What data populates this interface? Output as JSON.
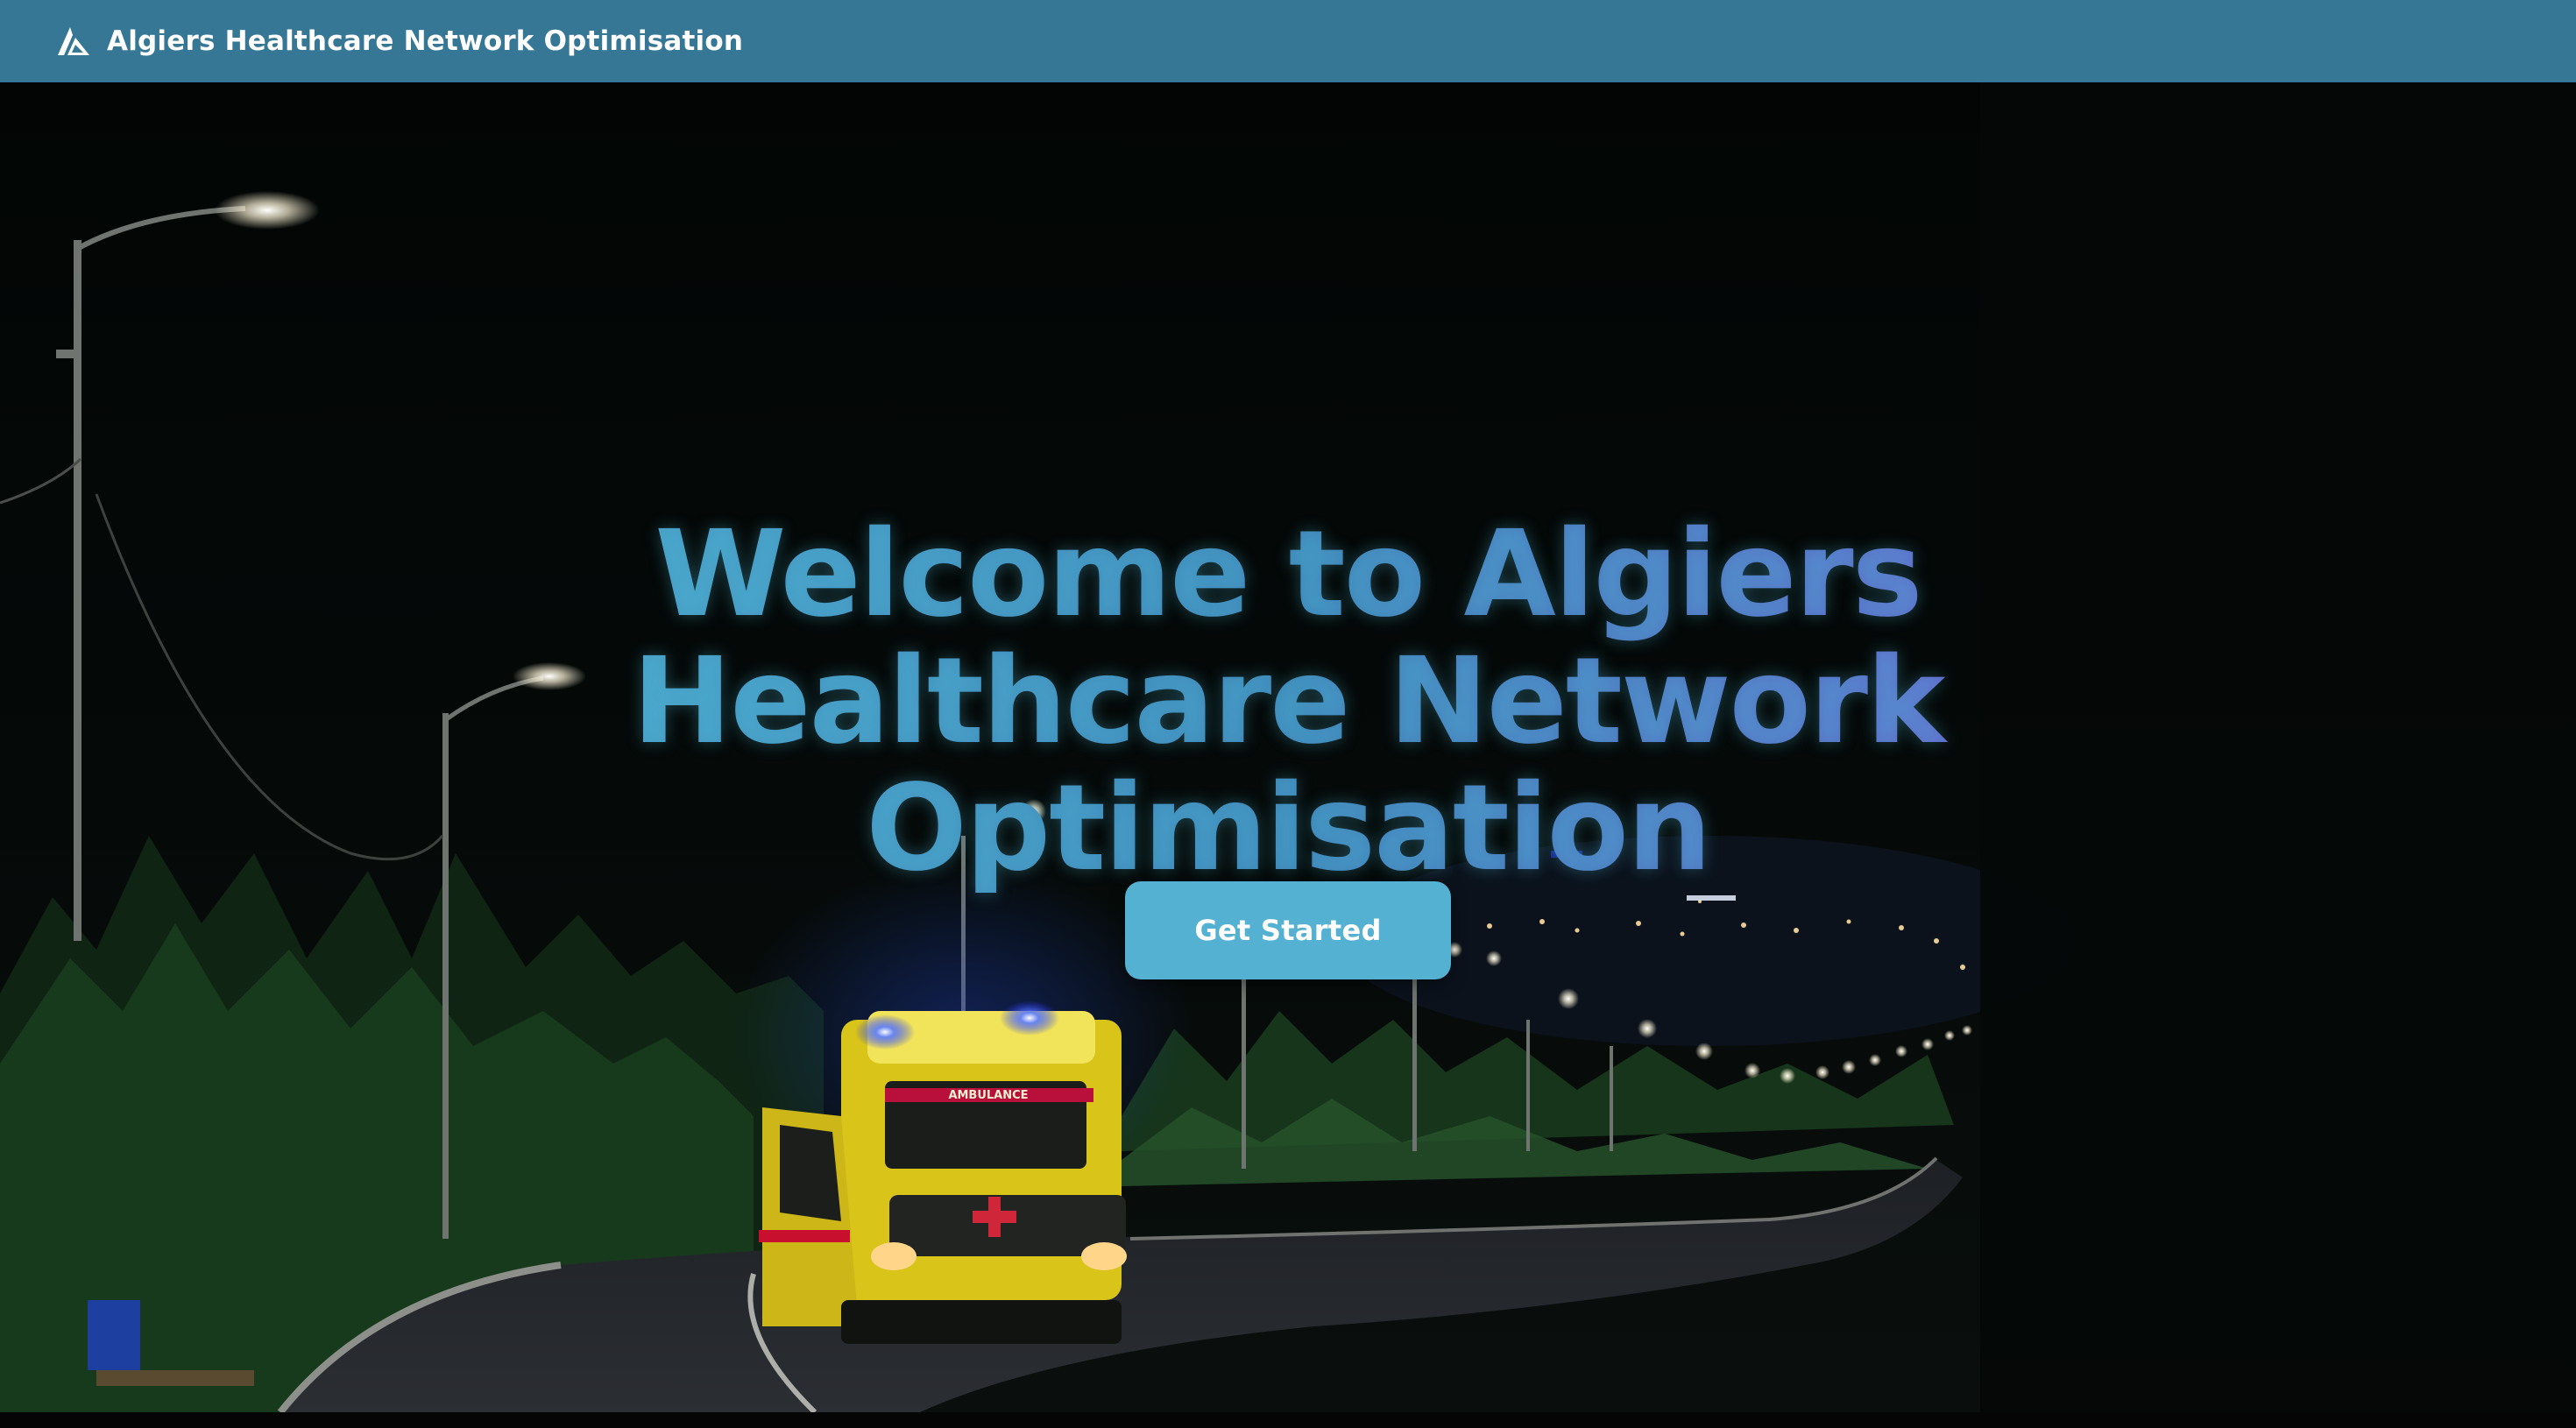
{
  "header": {
    "brand_icon": "triangle-logo-icon",
    "title": "Algiers Healthcare Network Optimisation",
    "background_color": "#367795"
  },
  "hero": {
    "title": "Welcome to Algiers Healthcare Network Optimisation",
    "cta_label": "Get Started",
    "cta_color": "#55b1d2",
    "background_image": "night road with ambulance, street lamps and trees",
    "ambulance_label": "AMBULANCE",
    "title_gradient": [
      "#4eb6d8",
      "#3f86b8",
      "#8c56dd"
    ]
  }
}
